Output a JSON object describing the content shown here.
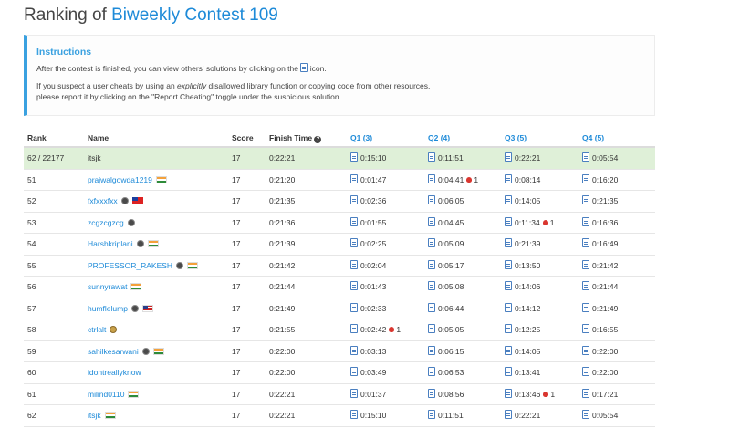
{
  "title": {
    "prefix": "Ranking of ",
    "contest": "Biweekly Contest 109"
  },
  "instructions": {
    "title": "Instructions",
    "line1_before": "After the contest is finished, you can view others' solutions by clicking on the ",
    "line1_after": " icon.",
    "line2_a": "If you suspect a user cheats by using an ",
    "line2_em": "explicitly",
    "line2_b": " disallowed library function or copying code from other resources,",
    "line2_c": "please report it by clicking on the \"Report Cheating\" toggle under the suspicious solution."
  },
  "headers": {
    "rank": "Rank",
    "name": "Name",
    "score": "Score",
    "finish_time": "Finish Time",
    "q1": "Q1 (3)",
    "q2": "Q2 (4)",
    "q3": "Q3 (5)",
    "q4": "Q4 (5)"
  },
  "rows": [
    {
      "rank": "62 / 22177",
      "name": "itsjk",
      "score": "17",
      "finish": "0:22:21",
      "q1": "0:15:10",
      "q2": "0:11:51",
      "q3": "0:22:21",
      "q4": "0:05:54",
      "me": true
    },
    {
      "rank": "51",
      "name": "prajwalgowda1219",
      "score": "17",
      "finish": "0:21:20",
      "q1": "0:01:47",
      "q2": "0:04:41",
      "q2_bugs": "1",
      "q3": "0:08:14",
      "q4": "0:16:20",
      "flag": "india"
    },
    {
      "rank": "52",
      "name": "fxfxxxfxx",
      "score": "17",
      "finish": "0:21:35",
      "q1": "0:02:36",
      "q2": "0:06:05",
      "q3": "0:14:05",
      "q4": "0:21:35",
      "badge": "knight",
      "flag": "taiwan"
    },
    {
      "rank": "53",
      "name": "zcgzcgzcg",
      "score": "17",
      "finish": "0:21:36",
      "q1": "0:01:55",
      "q2": "0:04:45",
      "q3": "0:11:34",
      "q3_bugs": "1",
      "q4": "0:16:36",
      "badge": "knight"
    },
    {
      "rank": "54",
      "name": "Harshkriplani",
      "score": "17",
      "finish": "0:21:39",
      "q1": "0:02:25",
      "q2": "0:05:09",
      "q3": "0:21:39",
      "q4": "0:16:49",
      "badge": "knight",
      "flag": "india"
    },
    {
      "rank": "55",
      "name": "PROFESSOR_RAKESH",
      "score": "17",
      "finish": "0:21:42",
      "q1": "0:02:04",
      "q2": "0:05:17",
      "q3": "0:13:50",
      "q4": "0:21:42",
      "badge": "knight",
      "flag": "india"
    },
    {
      "rank": "56",
      "name": "sunnyrawat",
      "score": "17",
      "finish": "0:21:44",
      "q1": "0:01:43",
      "q2": "0:05:08",
      "q3": "0:14:06",
      "q4": "0:21:44",
      "flag": "india"
    },
    {
      "rank": "57",
      "name": "humflelump",
      "score": "17",
      "finish": "0:21:49",
      "q1": "0:02:33",
      "q2": "0:06:44",
      "q3": "0:14:12",
      "q4": "0:21:49",
      "badge": "knight",
      "flag": "usa"
    },
    {
      "rank": "58",
      "name": "ctrlalt",
      "score": "17",
      "finish": "0:21:55",
      "q1": "0:02:42",
      "q1_bugs": "1",
      "q2": "0:05:05",
      "q3": "0:12:25",
      "q4": "0:16:55",
      "badge": "guardian"
    },
    {
      "rank": "59",
      "name": "sahilkesarwani",
      "score": "17",
      "finish": "0:22:00",
      "q1": "0:03:13",
      "q2": "0:06:15",
      "q3": "0:14:05",
      "q4": "0:22:00",
      "badge": "knight",
      "flag": "india"
    },
    {
      "rank": "60",
      "name": "idontreallyknow",
      "score": "17",
      "finish": "0:22:00",
      "q1": "0:03:49",
      "q2": "0:06:53",
      "q3": "0:13:41",
      "q4": "0:22:00"
    },
    {
      "rank": "61",
      "name": "milind0110",
      "score": "17",
      "finish": "0:22:21",
      "q1": "0:01:37",
      "q2": "0:08:56",
      "q3": "0:13:46",
      "q3_bugs": "1",
      "q4": "0:17:21",
      "flag": "india"
    },
    {
      "rank": "62",
      "name": "itsjk",
      "score": "17",
      "finish": "0:22:21",
      "q1": "0:15:10",
      "q2": "0:11:51",
      "q3": "0:22:21",
      "q4": "0:05:54",
      "flag": "india"
    }
  ]
}
